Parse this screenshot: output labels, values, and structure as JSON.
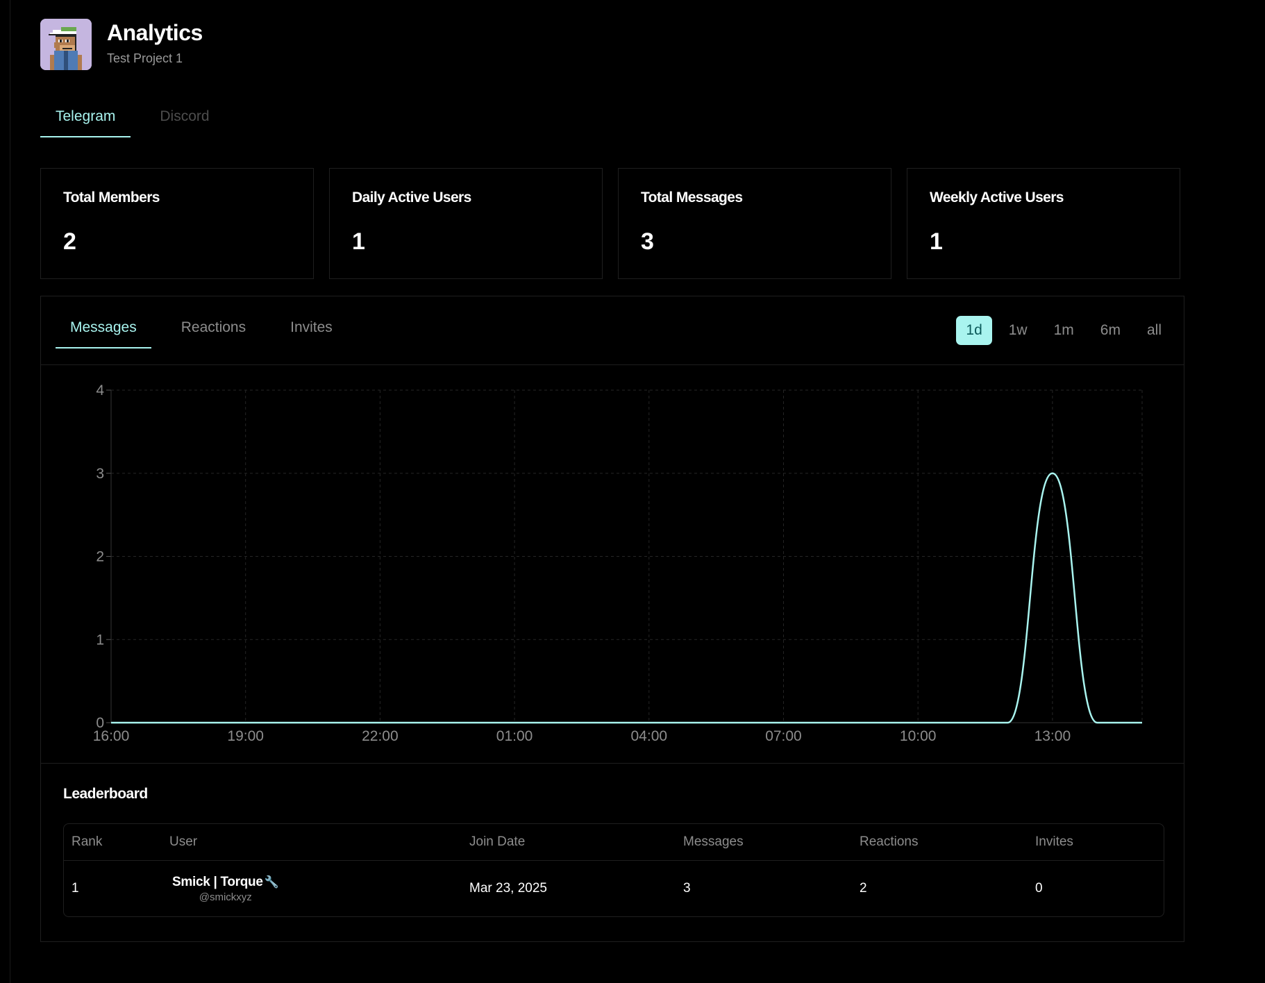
{
  "header": {
    "title": "Analytics",
    "subtitle": "Test Project 1"
  },
  "platform_tabs": [
    {
      "label": "Telegram",
      "active": true
    },
    {
      "label": "Discord",
      "active": false
    }
  ],
  "stats": [
    {
      "label": "Total Members",
      "value": "2"
    },
    {
      "label": "Daily Active Users",
      "value": "1"
    },
    {
      "label": "Total Messages",
      "value": "3"
    },
    {
      "label": "Weekly Active Users",
      "value": "1"
    }
  ],
  "metric_tabs": [
    {
      "label": "Messages",
      "active": true
    },
    {
      "label": "Reactions",
      "active": false
    },
    {
      "label": "Invites",
      "active": false
    }
  ],
  "ranges": [
    {
      "label": "1d",
      "active": true
    },
    {
      "label": "1w",
      "active": false
    },
    {
      "label": "1m",
      "active": false
    },
    {
      "label": "6m",
      "active": false
    },
    {
      "label": "all",
      "active": false
    }
  ],
  "colors": {
    "accent": "#a9f4ef",
    "background": "#000000",
    "muted_text": "#8d8d8d"
  },
  "chart_data": {
    "type": "line",
    "x_ticks": [
      "16:00",
      "19:00",
      "22:00",
      "01:00",
      "04:00",
      "07:00",
      "10:00",
      "13:00"
    ],
    "y_ticks": [
      0,
      1,
      2,
      3,
      4
    ],
    "ylim": [
      0,
      4
    ],
    "grid": true,
    "series": [
      {
        "x": [
          "16:00",
          "17:00",
          "18:00",
          "19:00",
          "20:00",
          "21:00",
          "22:00",
          "23:00",
          "00:00",
          "01:00",
          "02:00",
          "03:00",
          "04:00",
          "05:00",
          "06:00",
          "07:00",
          "08:00",
          "09:00",
          "10:00",
          "11:00",
          "12:00",
          "13:00",
          "14:00",
          "15:00"
        ],
        "values": [
          0,
          0,
          0,
          0,
          0,
          0,
          0,
          0,
          0,
          0,
          0,
          0,
          0,
          0,
          0,
          0,
          0,
          0,
          0,
          0,
          0,
          3,
          0,
          0
        ]
      }
    ]
  },
  "leaderboard": {
    "title": "Leaderboard",
    "columns": [
      "Rank",
      "User",
      "Join Date",
      "Messages",
      "Reactions",
      "Invites"
    ],
    "rows": [
      {
        "rank": "1",
        "name": "Smick | Torque",
        "handle": "@smickxyz",
        "join_date": "Mar 23, 2025",
        "messages": "3",
        "reactions": "2",
        "invites": "0"
      }
    ]
  }
}
